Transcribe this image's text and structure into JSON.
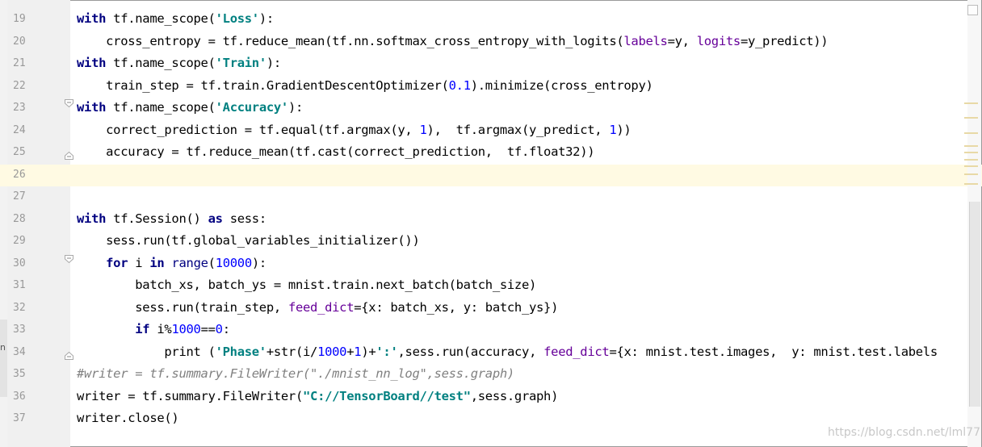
{
  "editor": {
    "lines": [
      {
        "number": "19",
        "segments": [
          {
            "t": "with",
            "c": "kw"
          },
          {
            "t": " tf.name_scope("
          },
          {
            "t": "'Loss'",
            "c": "str"
          },
          {
            "t": "):"
          }
        ]
      },
      {
        "number": "20",
        "segments": [
          {
            "t": "    cross_entropy = tf.reduce_mean(tf.nn.softmax_cross_entropy_with_logits("
          },
          {
            "t": "labels",
            "c": "param"
          },
          {
            "t": "=y, "
          },
          {
            "t": "logits",
            "c": "param"
          },
          {
            "t": "=y_predict))"
          }
        ]
      },
      {
        "number": "21",
        "segments": [
          {
            "t": "with",
            "c": "kw"
          },
          {
            "t": " tf.name_scope("
          },
          {
            "t": "'Train'",
            "c": "str"
          },
          {
            "t": "):"
          }
        ]
      },
      {
        "number": "22",
        "segments": [
          {
            "t": "    train_step = tf.train.GradientDescentOptimizer("
          },
          {
            "t": "0.1",
            "c": "num-lit"
          },
          {
            "t": ").minimize(cross_entropy)"
          }
        ]
      },
      {
        "number": "23",
        "segments": [
          {
            "t": "with",
            "c": "kw"
          },
          {
            "t": " tf.name_scope("
          },
          {
            "t": "'Accuracy'",
            "c": "str"
          },
          {
            "t": "):"
          }
        ]
      },
      {
        "number": "24",
        "segments": [
          {
            "t": "    correct_prediction = tf.equal(tf.argmax(y, "
          },
          {
            "t": "1",
            "c": "num-lit"
          },
          {
            "t": "),  tf.argmax(y_predict, "
          },
          {
            "t": "1",
            "c": "num-lit"
          },
          {
            "t": "))"
          }
        ]
      },
      {
        "number": "25",
        "segments": [
          {
            "t": "    accuracy = tf.reduce_mean(tf.cast(correct_prediction,  tf.float32))"
          }
        ]
      },
      {
        "number": "26",
        "segments": [],
        "current": true
      },
      {
        "number": "27",
        "segments": []
      },
      {
        "number": "28",
        "segments": [
          {
            "t": "with",
            "c": "kw"
          },
          {
            "t": " tf.Session() "
          },
          {
            "t": "as",
            "c": "kw"
          },
          {
            "t": " sess:"
          }
        ]
      },
      {
        "number": "29",
        "segments": [
          {
            "t": "    sess.run(tf.global_variables_initializer())"
          }
        ]
      },
      {
        "number": "30",
        "segments": [
          {
            "t": "    "
          },
          {
            "t": "for",
            "c": "kw"
          },
          {
            "t": " i "
          },
          {
            "t": "in",
            "c": "kw"
          },
          {
            "t": " "
          },
          {
            "t": "range",
            "c": "builtin"
          },
          {
            "t": "("
          },
          {
            "t": "10000",
            "c": "num-lit"
          },
          {
            "t": "):"
          }
        ]
      },
      {
        "number": "31",
        "segments": [
          {
            "t": "        batch_xs, batch_ys = mnist.train.next_batch(batch_size)"
          }
        ]
      },
      {
        "number": "32",
        "segments": [
          {
            "t": "        sess.run(train_step, "
          },
          {
            "t": "feed_dict",
            "c": "param"
          },
          {
            "t": "={x: batch_xs, y: batch_ys})"
          }
        ]
      },
      {
        "number": "33",
        "segments": [
          {
            "t": "        "
          },
          {
            "t": "if",
            "c": "kw"
          },
          {
            "t": " i%"
          },
          {
            "t": "1000",
            "c": "num-lit"
          },
          {
            "t": "=="
          },
          {
            "t": "0",
            "c": "num-lit"
          },
          {
            "t": ":"
          }
        ]
      },
      {
        "number": "34",
        "segments": [
          {
            "t": "            print ("
          },
          {
            "t": "'Phase'",
            "c": "str"
          },
          {
            "t": "+str(i/"
          },
          {
            "t": "1000",
            "c": "num-lit"
          },
          {
            "t": "+"
          },
          {
            "t": "1",
            "c": "num-lit"
          },
          {
            "t": ")+"
          },
          {
            "t": "':'",
            "c": "str"
          },
          {
            "t": ",sess.run(accuracy, "
          },
          {
            "t": "feed_dict",
            "c": "param"
          },
          {
            "t": "={x: mnist.test.images,  y: mnist.test.labels"
          }
        ]
      },
      {
        "number": "35",
        "segments": [
          {
            "t": "#writer = tf.summary.FileWriter(\"./mnist_nn_log\",sess.graph)",
            "c": "comment"
          }
        ]
      },
      {
        "number": "36",
        "segments": [
          {
            "t": "writer = tf.summary.FileWriter("
          },
          {
            "t": "\"C://TensorBoard//test\"",
            "c": "str"
          },
          {
            "t": ",sess.graph)"
          }
        ]
      },
      {
        "number": "37",
        "segments": [
          {
            "t": "writer.close()"
          }
        ]
      }
    ]
  },
  "watermark": "https://blog.csdn.net/lml77",
  "side_panel_char": "n"
}
